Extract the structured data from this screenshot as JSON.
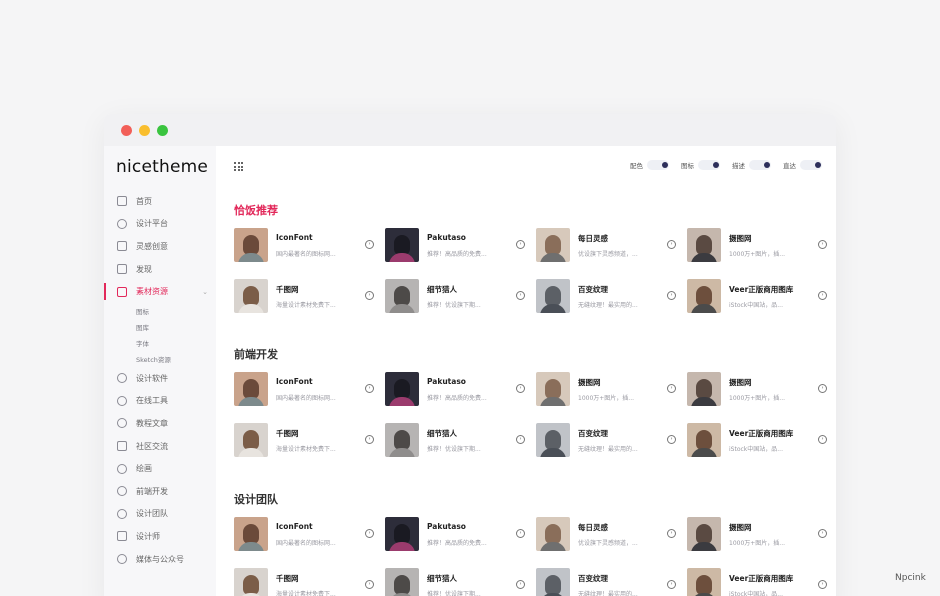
{
  "window": {
    "traffic_lights": [
      "close",
      "minimize",
      "maximize"
    ]
  },
  "sidebar": {
    "logo": "nicetheme",
    "items": [
      {
        "label": "首页",
        "icon": "file-icon"
      },
      {
        "label": "设计平台",
        "icon": "location-icon"
      },
      {
        "label": "灵感创意",
        "icon": "shirt-icon"
      },
      {
        "label": "发现",
        "icon": "book-icon"
      },
      {
        "label": "素材资源",
        "icon": "briefcase-icon",
        "active": true
      },
      {
        "label": "设计软件",
        "icon": "compass-icon"
      },
      {
        "label": "在线工具",
        "icon": "globe-icon"
      },
      {
        "label": "教程文章",
        "icon": "flame-icon"
      },
      {
        "label": "社区交流",
        "icon": "image-icon"
      },
      {
        "label": "绘画",
        "icon": "gear-icon"
      },
      {
        "label": "前端开发",
        "icon": "music-icon"
      },
      {
        "label": "设计团队",
        "icon": "palette-icon"
      },
      {
        "label": "设计师",
        "icon": "building-icon"
      },
      {
        "label": "媒体与公众号",
        "icon": "globe-icon"
      }
    ],
    "sub_items": [
      "图标",
      "图库",
      "字体",
      "Sketch资源"
    ]
  },
  "header": {
    "toggles": [
      {
        "label": "配色"
      },
      {
        "label": "图标"
      },
      {
        "label": "描述"
      },
      {
        "label": "直达"
      }
    ]
  },
  "sections": [
    {
      "title": "恰饭推荐",
      "accent": true,
      "cards": [
        {
          "name": "IconFont",
          "desc": "国内最著名的图标网..."
        },
        {
          "name": "Pakutaso",
          "desc": "推荐！高品质的免费..."
        },
        {
          "name": "每日灵感",
          "desc": "优设旗下灵感频道，..."
        },
        {
          "name": "摄图网",
          "desc": "1000万+图片，插..."
        },
        {
          "name": "千图网",
          "desc": "海量设计素材免费下..."
        },
        {
          "name": "细节猎人",
          "desc": "推荐！优设旗下期..."
        },
        {
          "name": "百变纹理",
          "desc": "无缝纹理！最实用的..."
        },
        {
          "name": "Veer正版商用图库",
          "desc": "iStock中国站，品..."
        }
      ]
    },
    {
      "title": "前端开发",
      "accent": false,
      "cards": [
        {
          "name": "IconFont",
          "desc": "国内最著名的图标网..."
        },
        {
          "name": "Pakutaso",
          "desc": "推荐！高品质的免费..."
        },
        {
          "name": "摄图网",
          "desc": "1000万+图片，插..."
        },
        {
          "name": "摄图网",
          "desc": "1000万+图片，插..."
        },
        {
          "name": "千图网",
          "desc": "海量设计素材免费下..."
        },
        {
          "name": "细节猎人",
          "desc": "推荐！优设旗下期..."
        },
        {
          "name": "百变纹理",
          "desc": "无缝纹理！最实用的..."
        },
        {
          "name": "Veer正版商用图库",
          "desc": "iStock中国站，品..."
        }
      ]
    },
    {
      "title": "设计团队",
      "accent": false,
      "cards": [
        {
          "name": "IconFont",
          "desc": "国内最著名的图标网..."
        },
        {
          "name": "Pakutaso",
          "desc": "推荐！高品质的免费..."
        },
        {
          "name": "每日灵感",
          "desc": "优设旗下灵感频道，..."
        },
        {
          "name": "摄图网",
          "desc": "1000万+图片，插..."
        },
        {
          "name": "千图网",
          "desc": "海量设计素材免费下..."
        },
        {
          "name": "细节猎人",
          "desc": "推荐！优设旗下期..."
        },
        {
          "name": "百变纹理",
          "desc": "无缝纹理！最实用的..."
        },
        {
          "name": "Veer正版商用图库",
          "desc": "iStock中国站，品..."
        }
      ]
    }
  ],
  "colors": {
    "accent": "#e2285a",
    "toggle_dot": "#2c2e5a"
  },
  "watermark": "Npcink"
}
